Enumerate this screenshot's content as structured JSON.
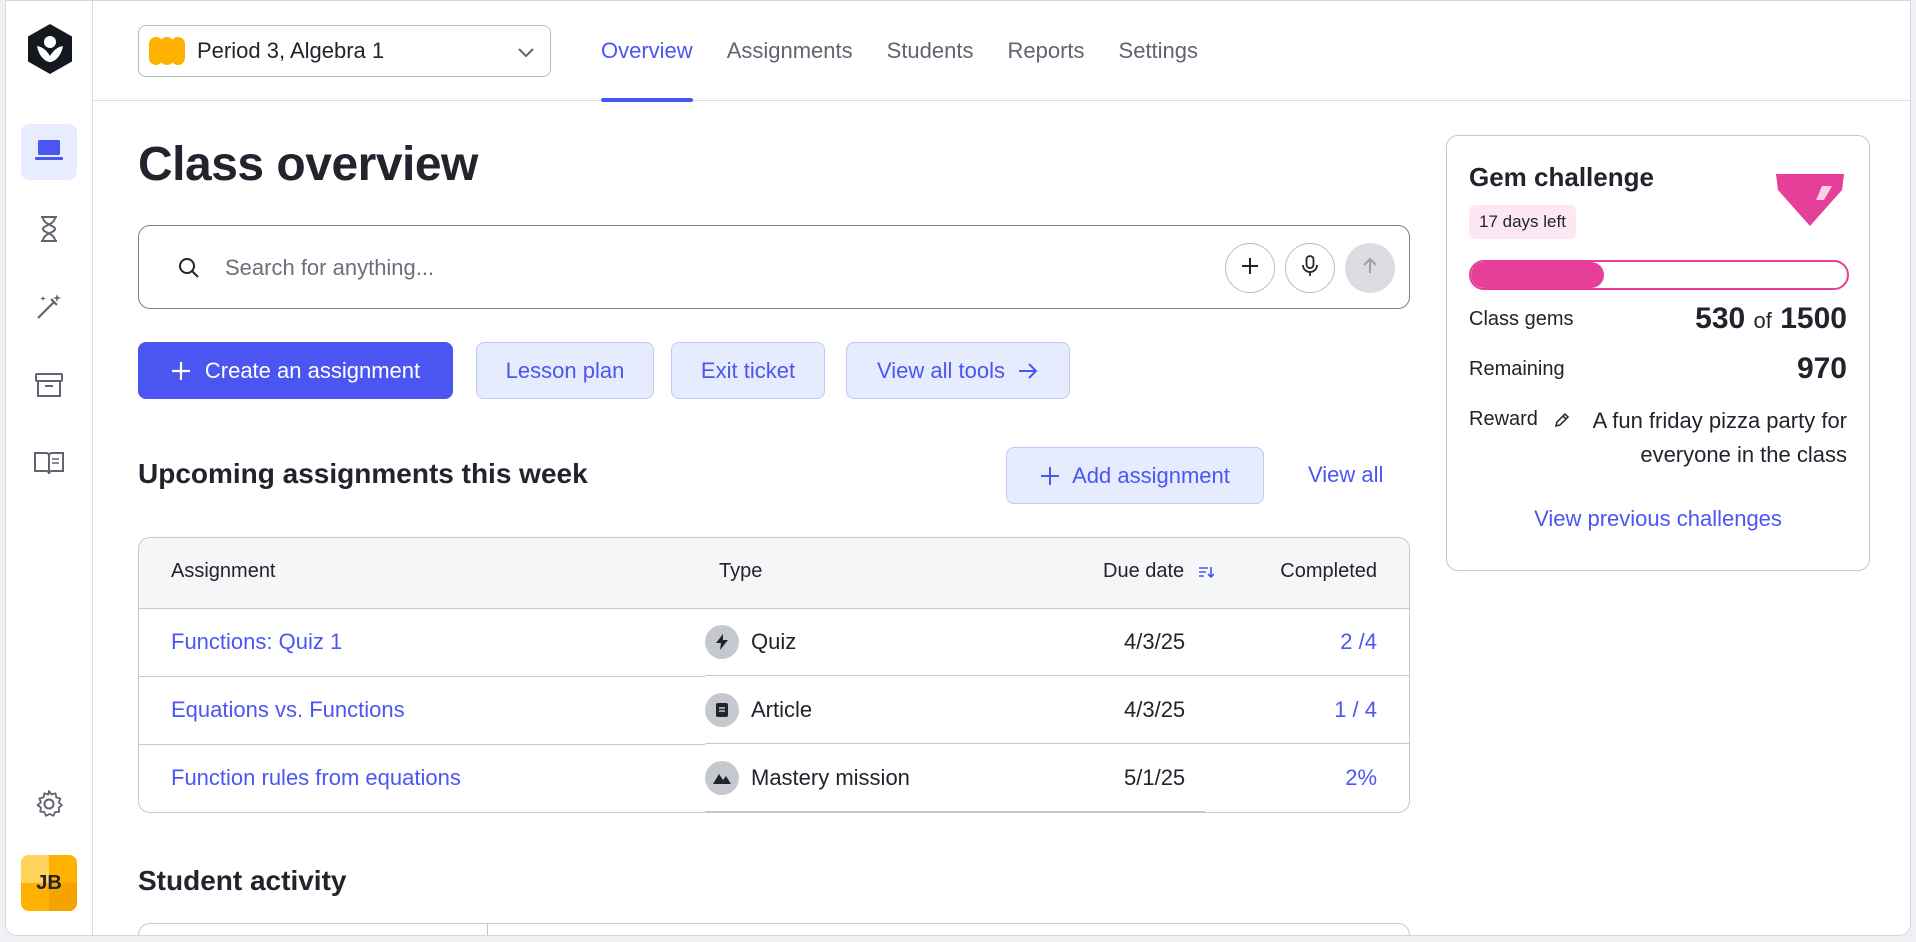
{
  "class_selector": {
    "label": "Period 3, Algebra 1"
  },
  "tabs": [
    {
      "label": "Overview",
      "active": true
    },
    {
      "label": "Assignments",
      "active": false
    },
    {
      "label": "Students",
      "active": false
    },
    {
      "label": "Reports",
      "active": false
    },
    {
      "label": "Settings",
      "active": false
    }
  ],
  "page_title": "Class overview",
  "search": {
    "placeholder": "Search for anything..."
  },
  "tools": {
    "create": "Create an assignment",
    "lesson_plan": "Lesson plan",
    "exit_ticket": "Exit ticket",
    "view_all": "View all tools"
  },
  "upcoming": {
    "title": "Upcoming assignments this week",
    "add_label": "Add assignment",
    "view_all": "View all",
    "columns": {
      "assignment": "Assignment",
      "type": "Type",
      "due": "Due date",
      "completed": "Completed"
    },
    "rows": [
      {
        "name": "Functions: Quiz 1",
        "type": "Quiz",
        "type_icon": "lightning-icon",
        "due": "4/3/25",
        "completed": "2 /4"
      },
      {
        "name": "Equations vs. Functions",
        "type": "Article",
        "type_icon": "article-icon",
        "due": "4/3/25",
        "completed": "1 / 4"
      },
      {
        "name": "Function rules from equations",
        "type": "Mastery mission",
        "type_icon": "mountain-icon",
        "due": "5/1/25",
        "completed": "2%"
      }
    ]
  },
  "student_activity": {
    "title": "Student activity"
  },
  "gem_challenge": {
    "title": "Gem challenge",
    "days_left": "17 days left",
    "progress_fraction": 0.353,
    "class_gems_label": "Class gems",
    "class_gems_value": "530",
    "of_word": "of",
    "class_gems_total": "1500",
    "remaining_label": "Remaining",
    "remaining_value": "970",
    "reward_label": "Reward",
    "reward_text": "A fun friday pizza party for everyone in the class",
    "view_previous": "View previous challenges"
  },
  "user": {
    "initials": "JB"
  },
  "colors": {
    "accent": "#4b56f2",
    "gem_pink": "#e53f99",
    "class_color": "#ffb100"
  }
}
